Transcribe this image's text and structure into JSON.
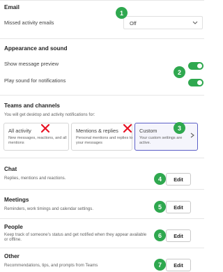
{
  "email": {
    "title": "Email",
    "missed_activity_label": "Missed activity emails",
    "missed_activity_value": "Off"
  },
  "appearance": {
    "title": "Appearance and sound",
    "show_preview_label": "Show message preview",
    "show_preview_on": true,
    "play_sound_label": "Play sound for notifications",
    "play_sound_on": true
  },
  "teams": {
    "title": "Teams and channels",
    "subtitle": "You will get desktop and activity notifications for:",
    "cards": [
      {
        "title": "All activity",
        "desc": "New messages, reactions, and all mentions"
      },
      {
        "title": "Mentions & replies",
        "desc": "Personal mentions and replies to your messages"
      },
      {
        "title": "Custom",
        "desc": "Your custom settings are active."
      }
    ]
  },
  "chat": {
    "title": "Chat",
    "desc": "Replies, mentions and reactions.",
    "edit": "Edit"
  },
  "meetings": {
    "title": "Meetings",
    "desc": "Reminders, work timings and calendar settings.",
    "edit": "Edit"
  },
  "people": {
    "title": "People",
    "desc": "Keep track of someone's status and get notified when they appear available or offline.",
    "edit": "Edit"
  },
  "other": {
    "title": "Other",
    "desc": "Recommendations, tips, and prompts from Teams",
    "edit": "Edit"
  },
  "badges": [
    "1",
    "2",
    "3",
    "4",
    "5",
    "6",
    "7"
  ],
  "colors": {
    "badge": "#2fa84f",
    "toggle_on": "#2fa84f",
    "x_mark": "#e81123",
    "selected_border": "#5b5fc7"
  },
  "icons": {
    "dropdown": "chevron-down-icon",
    "card_more": "chevron-right-icon",
    "not_selected": "x-mark-icon"
  }
}
